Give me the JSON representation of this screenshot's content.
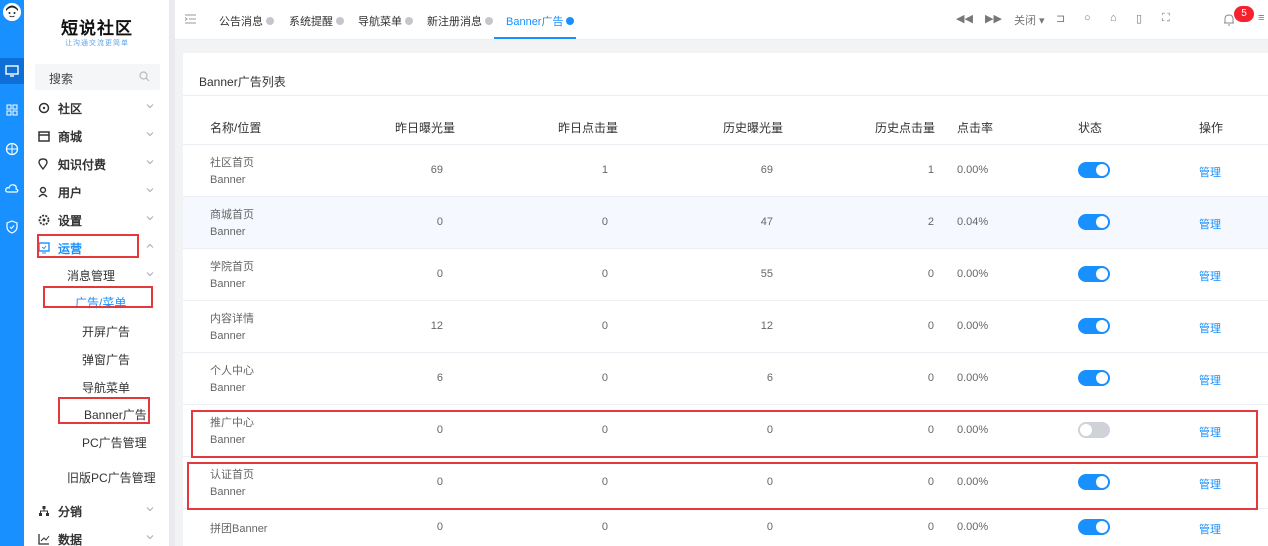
{
  "app": {
    "logo_title": "短说社区",
    "logo_slogan": "让沟通交流更简单"
  },
  "rail_icons": [
    "avatar-icon",
    "monitor-icon",
    "grid-icon",
    "globe-icon",
    "cloud-icon",
    "shield-icon"
  ],
  "sidebar": {
    "search_placeholder": "搜索",
    "menu": [
      {
        "label": "社区",
        "icon": "community-icon"
      },
      {
        "label": "商城",
        "icon": "shop-icon"
      },
      {
        "label": "知识付费",
        "icon": "location-icon"
      },
      {
        "label": "用户",
        "icon": "user-icon"
      },
      {
        "label": "设置",
        "icon": "settings-icon"
      },
      {
        "label": "运营",
        "icon": "operation-icon"
      }
    ],
    "sub_menu": {
      "message_mgmt": "消息管理",
      "ad_menu": "广告/菜单",
      "items": [
        "开屏广告",
        "弹窗广告",
        "导航菜单",
        "Banner广告",
        "PC广告管理"
      ],
      "legacy_pc": "旧版PC广告管理"
    },
    "bottom_menu": [
      {
        "label": "分销",
        "icon": "distribution-icon"
      },
      {
        "label": "数据",
        "icon": "chart-icon"
      }
    ]
  },
  "tabs": {
    "items": [
      "公告消息",
      "系统提醒",
      "导航菜单",
      "新注册消息",
      "Banner广告"
    ],
    "active_index": 4,
    "close_label": "关闭",
    "notification_count": "5"
  },
  "content": {
    "title": "Banner广告列表",
    "columns": [
      "名称/位置",
      "昨日曝光量",
      "昨日点击量",
      "历史曝光量",
      "历史点击量",
      "点击率",
      "状态",
      "操作"
    ],
    "manage_label": "管理",
    "rows": [
      {
        "name": "社区首页",
        "pos": "Banner",
        "y_exp": "69",
        "y_clk": "1",
        "h_exp": "69",
        "h_clk": "1",
        "rate": "0.00%",
        "on": true
      },
      {
        "name": "商城首页",
        "pos": "Banner",
        "y_exp": "0",
        "y_clk": "0",
        "h_exp": "47",
        "h_clk": "2",
        "rate": "0.04%",
        "on": true
      },
      {
        "name": "学院首页",
        "pos": "Banner",
        "y_exp": "0",
        "y_clk": "0",
        "h_exp": "55",
        "h_clk": "0",
        "rate": "0.00%",
        "on": true
      },
      {
        "name": "内容详情",
        "pos": "Banner",
        "y_exp": "12",
        "y_clk": "0",
        "h_exp": "12",
        "h_clk": "0",
        "rate": "0.00%",
        "on": true
      },
      {
        "name": "个人中心",
        "pos": "Banner",
        "y_exp": "6",
        "y_clk": "0",
        "h_exp": "6",
        "h_clk": "0",
        "rate": "0.00%",
        "on": true
      },
      {
        "name": "推广中心",
        "pos": "Banner",
        "y_exp": "0",
        "y_clk": "0",
        "h_exp": "0",
        "h_clk": "0",
        "rate": "0.00%",
        "on": false
      },
      {
        "name": "认证首页",
        "pos": "Banner",
        "y_exp": "0",
        "y_clk": "0",
        "h_exp": "0",
        "h_clk": "0",
        "rate": "0.00%",
        "on": true
      },
      {
        "name": "拼团Banner",
        "pos": "",
        "y_exp": "0",
        "y_clk": "0",
        "h_exp": "0",
        "h_clk": "0",
        "rate": "0.00%",
        "on": true
      }
    ]
  },
  "colors": {
    "accent": "#1890ff",
    "highlight_box": "#e4393c"
  }
}
